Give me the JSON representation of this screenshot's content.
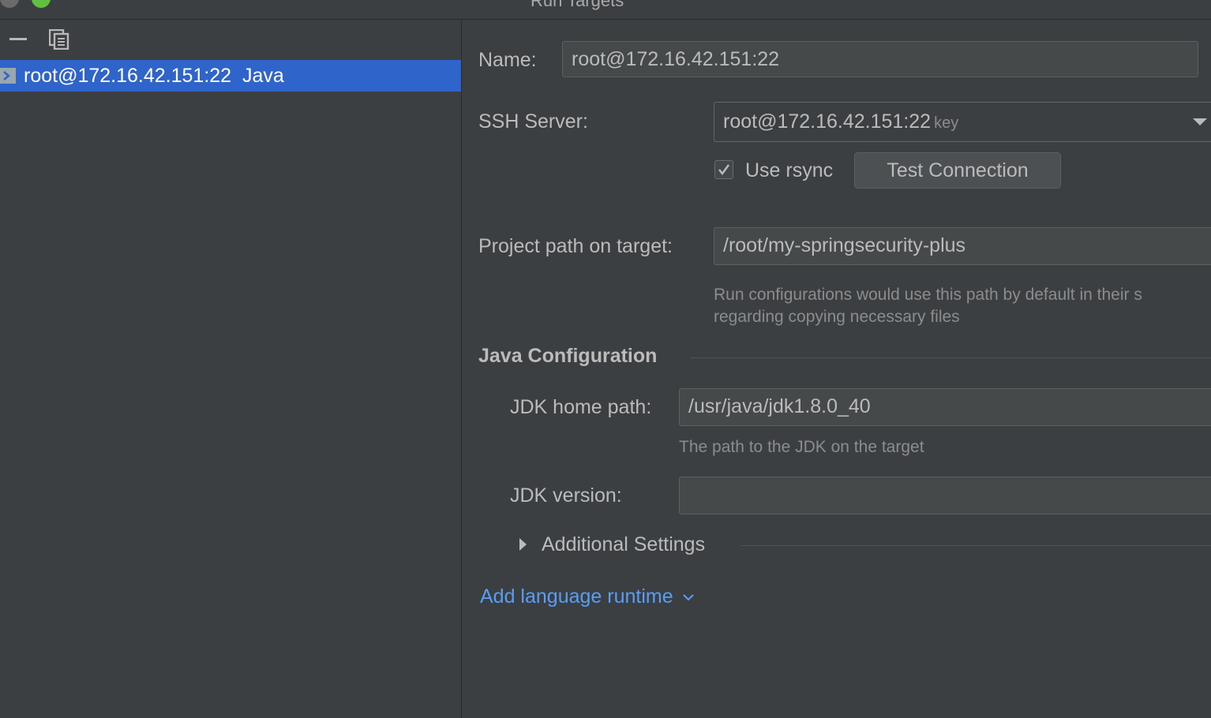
{
  "window": {
    "title": "Run Targets"
  },
  "sidebar": {
    "toolbar": {
      "remove_icon": "minus-icon",
      "copy_icon": "copy-icon"
    },
    "items": [
      {
        "label": "root@172.16.42.151:22  Java",
        "icon": "ssh-target-icon",
        "selected": true
      }
    ]
  },
  "form": {
    "name_label": "Name:",
    "name_value": "root@172.16.42.151:22",
    "ssh_label": "SSH Server:",
    "ssh_value": "root@172.16.42.151:22",
    "ssh_suffix": "key",
    "rsync_label": "Use rsync",
    "rsync_checked": true,
    "test_button": "Test Connection",
    "project_path_label": "Project path on target:",
    "project_path_value": "/root/my-springsecurity-plus",
    "project_path_hint_line1": "Run configurations would use this path by default in their s",
    "project_path_hint_line2": "regarding copying necessary files"
  },
  "java_config": {
    "title": "Java Configuration",
    "jdk_home_label": "JDK home path:",
    "jdk_home_value": "/usr/java/jdk1.8.0_40",
    "jdk_home_hint": "The path to the JDK on the target",
    "jdk_version_label": "JDK version:",
    "jdk_version_value": "",
    "additional_settings": "Additional Settings"
  },
  "add_runtime_link": "Add language runtime",
  "colors": {
    "background": "#3c3f41",
    "selection": "#2f65ca",
    "link": "#589df6"
  }
}
